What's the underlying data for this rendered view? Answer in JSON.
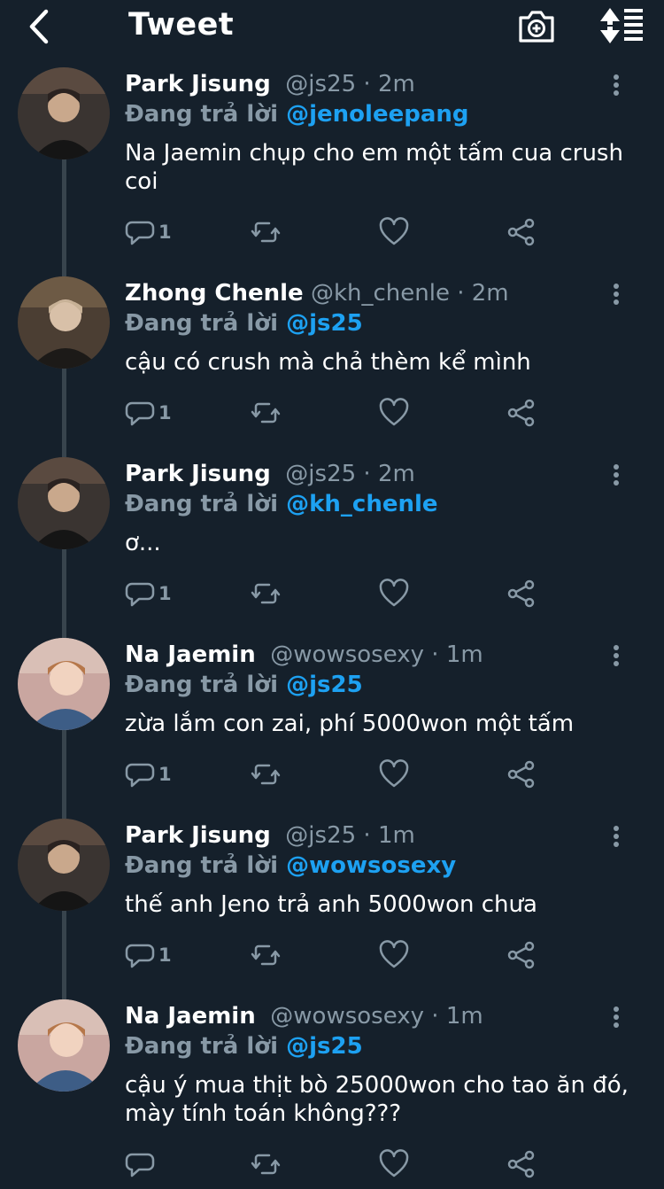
{
  "header": {
    "title": "Tweet"
  },
  "reply_prefix": "Đang trả lời",
  "tweets": [
    {
      "name": "Park Jisung",
      "handle": "@js25",
      "time": "2m",
      "reply_to": "@jenoleepang",
      "text": "Na Jaemin chụp cho em một tấm cua crush coi",
      "reply_count": "1"
    },
    {
      "name": "Zhong Chenle",
      "handle": "@kh_chenle",
      "time": "2m",
      "reply_to": "@js25",
      "text": "cậu có crush mà chả thèm kể mình",
      "reply_count": "1"
    },
    {
      "name": "Park Jisung",
      "handle": "@js25",
      "time": "2m",
      "reply_to": "@kh_chenle",
      "text": "ơ...",
      "reply_count": "1"
    },
    {
      "name": "Na Jaemin",
      "handle": "@wowsosexy",
      "time": "1m",
      "reply_to": "@js25",
      "text": "zừa lắm con zai, phí 5000won một tấm",
      "reply_count": "1"
    },
    {
      "name": "Park Jisung",
      "handle": "@js25",
      "time": "1m",
      "reply_to": "@wowsosexy",
      "text": "thế anh Jeno trả anh 5000won chưa",
      "reply_count": "1"
    },
    {
      "name": "Na Jaemin",
      "handle": "@wowsosexy",
      "time": "1m",
      "reply_to": "@js25",
      "text": "cậu ý mua thịt bò 25000won cho tao ăn đó, mày tính toán không???",
      "reply_count": ""
    }
  ],
  "colors": {
    "background": "#15202b",
    "accent": "#1da1f2",
    "secondary_text": "#8899a6",
    "thread_line": "#38444d"
  },
  "icons": [
    "back-chevron-icon",
    "camera-plus-icon",
    "sort-icon",
    "more-vertical-icon",
    "reply-icon",
    "retweet-icon",
    "like-icon",
    "share-icon"
  ]
}
